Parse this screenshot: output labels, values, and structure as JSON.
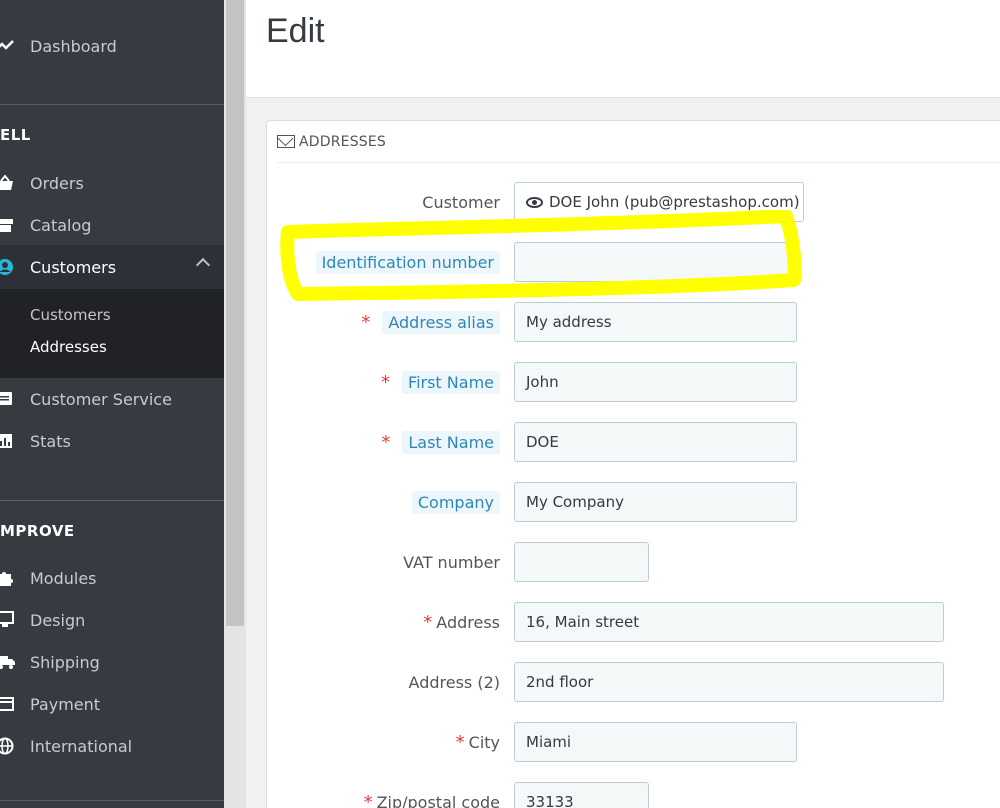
{
  "sidebar": {
    "dashboard": "Dashboard",
    "sell_section": "ELL",
    "orders": "Orders",
    "catalog": "Catalog",
    "customers": "Customers",
    "sub_customers": "Customers",
    "sub_addresses": "Addresses",
    "customer_service": "Customer Service",
    "stats": "Stats",
    "improve_section": "MPROVE",
    "modules": "Modules",
    "design": "Design",
    "shipping": "Shipping",
    "payment": "Payment",
    "international": "International"
  },
  "header": {
    "title": "Edit"
  },
  "panel": {
    "title": "ADDRESSES"
  },
  "form": {
    "customer_label": "Customer",
    "customer_value": "DOE John (pub@prestashop.com)",
    "identification_label": "Identification number",
    "identification_value": "",
    "alias_label": "Address alias",
    "alias_value": "My address",
    "firstname_label": "First Name",
    "firstname_value": "John",
    "lastname_label": "Last Name",
    "lastname_value": "DOE",
    "company_label": "Company",
    "company_value": "My Company",
    "vat_label": "VAT number",
    "vat_value": "",
    "address_label": "Address",
    "address_value": "16, Main street",
    "address2_label": "Address (2)",
    "address2_value": "2nd floor",
    "city_label": "City",
    "city_value": "Miami",
    "zip_label": "Zip/postal code",
    "zip_value": "33133",
    "required_mark": "*"
  },
  "colors": {
    "sidebar_bg": "#363a41",
    "highlight": "#ffff00",
    "label_tag_text": "#2f87b3",
    "required": "#e23a3a"
  }
}
